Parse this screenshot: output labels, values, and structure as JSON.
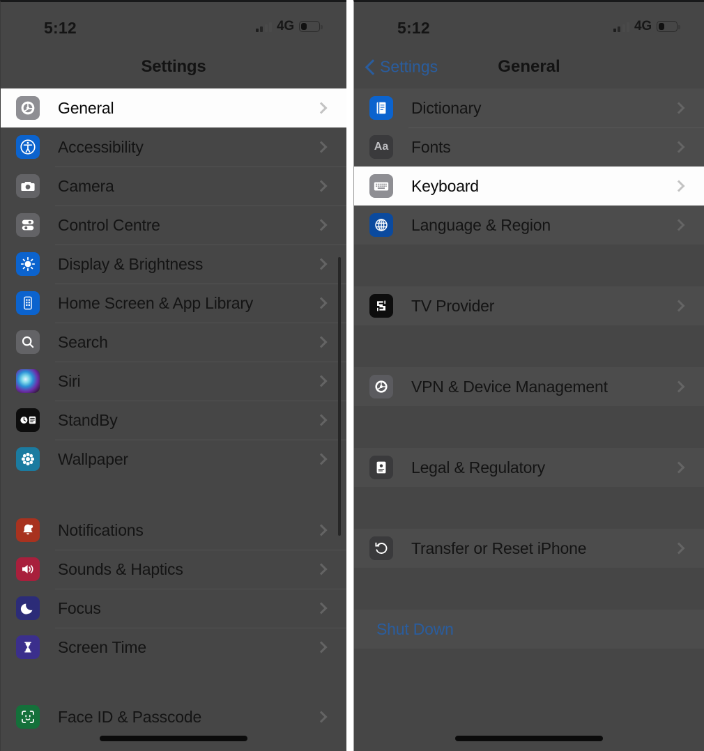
{
  "left_panel": {
    "status": {
      "time": "5:12",
      "network": "4G",
      "signal_icon": "cellular-bars-icon",
      "battery_icon": "battery-low-icon"
    },
    "nav": {
      "title": "Settings"
    },
    "groups": [
      {
        "id": "general-group",
        "highlight_first": true,
        "rows": [
          {
            "label": "General",
            "icon": "gear-icon",
            "icon_bg": "#8e8e93",
            "highlighted": true
          }
        ]
      },
      {
        "id": "apps-group",
        "rows": [
          {
            "label": "Accessibility",
            "icon": "accessibility-icon",
            "icon_bg": "#0b63ce"
          },
          {
            "label": "Camera",
            "icon": "camera-icon",
            "icon_bg": "#636366"
          },
          {
            "label": "Control Centre",
            "icon": "control-centre-icon",
            "icon_bg": "#636366"
          },
          {
            "label": "Display & Brightness",
            "icon": "brightness-icon",
            "icon_bg": "#0b63ce"
          },
          {
            "label": "Home Screen & App Library",
            "icon": "home-screen-icon",
            "icon_bg": "#0b63ce"
          },
          {
            "label": "Search",
            "icon": "search-icon",
            "icon_bg": "#636366"
          },
          {
            "label": "Siri",
            "icon": "siri-icon",
            "icon_bg": "#1b1b2a"
          },
          {
            "label": "StandBy",
            "icon": "standby-icon",
            "icon_bg": "#0d0d0d"
          },
          {
            "label": "Wallpaper",
            "icon": "wallpaper-icon",
            "icon_bg": "#1b7ba0"
          }
        ]
      },
      {
        "id": "notifications-group",
        "rows": [
          {
            "label": "Notifications",
            "icon": "bell-icon",
            "icon_bg": "#a8321f"
          },
          {
            "label": "Sounds & Haptics",
            "icon": "speaker-icon",
            "icon_bg": "#a81f3c"
          },
          {
            "label": "Focus",
            "icon": "moon-icon",
            "icon_bg": "#2c2c78"
          },
          {
            "label": "Screen Time",
            "icon": "hourglass-icon",
            "icon_bg": "#3b2f8c"
          }
        ]
      },
      {
        "id": "security-group",
        "rows": [
          {
            "label": "Face ID & Passcode",
            "icon": "face-id-icon",
            "icon_bg": "#14703a"
          }
        ]
      }
    ]
  },
  "right_panel": {
    "status": {
      "time": "5:12",
      "network": "4G",
      "signal_icon": "cellular-bars-icon",
      "battery_icon": "battery-low-icon"
    },
    "nav": {
      "back_label": "Settings",
      "back_icon": "chevron-left-icon",
      "title": "General"
    },
    "groups": [
      {
        "id": "input-group",
        "rows": [
          {
            "label": "Dictionary",
            "icon": "book-icon",
            "icon_bg": "#0b63ce"
          },
          {
            "label": "Fonts",
            "icon": "fonts-icon",
            "icon_bg": "#3a3a3c"
          },
          {
            "label": "Keyboard",
            "icon": "keyboard-icon",
            "icon_bg": "#8e8e93",
            "highlighted": true
          },
          {
            "label": "Language & Region",
            "icon": "globe-icon",
            "icon_bg": "#0b4a9e"
          }
        ]
      },
      {
        "id": "tv-group",
        "rows": [
          {
            "label": "TV Provider",
            "icon": "tv-provider-icon",
            "icon_bg": "#0d0d0d"
          }
        ]
      },
      {
        "id": "vpn-group",
        "rows": [
          {
            "label": "VPN & Device Management",
            "icon": "vpn-gear-icon",
            "icon_bg": "#5b5b5f"
          }
        ]
      },
      {
        "id": "legal-group",
        "rows": [
          {
            "label": "Legal & Regulatory",
            "icon": "legal-icon",
            "icon_bg": "#3a3a3c"
          }
        ]
      },
      {
        "id": "reset-group",
        "rows": [
          {
            "label": "Transfer or Reset iPhone",
            "icon": "reset-icon",
            "icon_bg": "#3a3a3c"
          }
        ]
      },
      {
        "id": "shutdown-group",
        "rows": [
          {
            "label": "Shut Down",
            "action": true
          }
        ]
      }
    ]
  },
  "colors": {
    "panel_bg": "#464646",
    "group_bg": "#4e4e4e",
    "highlight_bg": "#fdfdfd",
    "link_blue": "#2a5d9e",
    "text": "#141414"
  }
}
